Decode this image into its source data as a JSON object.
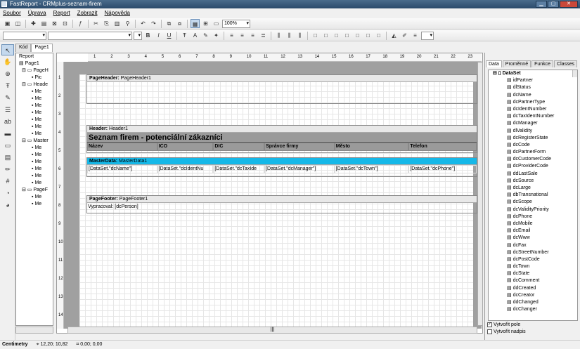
{
  "window": {
    "title": "FastReport - CRMplus-seznam-firem",
    "min": "▁",
    "max": "▢",
    "close": "✕"
  },
  "menu": [
    "Soubor",
    "Úprava",
    "Report",
    "Zobrazit",
    "Nápověda"
  ],
  "toolbar": {
    "zoom": "100%"
  },
  "left_tabs": {
    "code": "Kód",
    "page": "Page1"
  },
  "report_tree": {
    "root": "Report",
    "page": "Page1",
    "items": [
      "PageH",
      "Pic",
      "Heade",
      "Me",
      "Me",
      "Me",
      "Me",
      "Me",
      "Me",
      "Me",
      "Master",
      "Me",
      "Me",
      "Me",
      "Me",
      "Me",
      "Me",
      "PageF",
      "Me",
      "Me"
    ]
  },
  "bands": {
    "page_header": {
      "kind": "PageHeader:",
      "name": "PageHeader1"
    },
    "header": {
      "kind": "Header:",
      "name": "Header1",
      "title": "Seznam firem - potenciální zákazníci",
      "columns": [
        "Název",
        "IČO",
        "DIČ",
        "Správce firmy",
        "Město",
        "Telefon"
      ]
    },
    "master": {
      "kind": "MasterData:",
      "name": "MasterData1",
      "fields": [
        "[DataSet.\"dcName\"]",
        "[DataSet.\"dcIdentNu",
        "[DataSet.\"dcTaxIde",
        "[DataSet.\"dcManager\"]",
        "[DataSet.\"dcTown\"]",
        "[DataSet.\"dcPhone\"]"
      ]
    },
    "page_footer": {
      "kind": "PageFooter:",
      "name": "PageFooter1",
      "text": "Vypracoval: [dcPerson]"
    }
  },
  "right_panel": {
    "tabs": [
      "Data",
      "Proměnné",
      "Funkce",
      "Classes"
    ],
    "dataset": "DataSet",
    "fields": [
      "idPartner",
      "dlStatus",
      "dcName",
      "dcPartnerType",
      "dcIdentNumber",
      "dcTaxIdentNumber",
      "dcManager",
      "dlValidity",
      "dcRegisterState",
      "dcCode",
      "dcPartnerForm",
      "dcCustomerCode",
      "dcProviderCode",
      "ddLastSale",
      "dcSource",
      "dcLarge",
      "dbTransnational",
      "dcScope",
      "dcValidityPriority",
      "dcPhone",
      "dcMobile",
      "dcEmail",
      "dcWww",
      "dcFax",
      "dcStreetNumber",
      "dcPostCode",
      "dcTown",
      "dcState",
      "dcComment",
      "ddCreated",
      "dcCreator",
      "ddChanged",
      "dcChanger"
    ],
    "check_create_field": "Vytvořit pole",
    "check_create_title": "Vytvořit nadpis"
  },
  "status": {
    "units": "Centimetry",
    "pos1": "12,20; 10,82",
    "pos2": "0,00; 0,00"
  },
  "ruler_h": [
    "1",
    "2",
    "3",
    "4",
    "5",
    "6",
    "7",
    "8",
    "9",
    "10",
    "11",
    "12",
    "13",
    "14",
    "15",
    "16",
    "17",
    "18",
    "19",
    "20",
    "21",
    "22",
    "23"
  ],
  "ruler_v": [
    "1",
    "2",
    "3",
    "4",
    "5",
    "6",
    "7",
    "8",
    "9",
    "10",
    "11",
    "12",
    "13",
    "14"
  ]
}
